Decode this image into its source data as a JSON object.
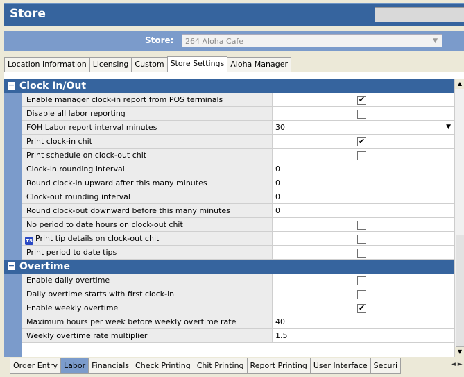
{
  "window": {
    "title": "Store"
  },
  "store_selector": {
    "label": "Store:",
    "value": "264 Aloha Cafe"
  },
  "top_tabs": [
    "Location Information",
    "Licensing",
    "Custom",
    "Store Settings",
    "Aloha Manager"
  ],
  "active_top_tab": "Store Settings",
  "sections": [
    {
      "title": "Clock In/Out",
      "rows": [
        {
          "label": "Enable manager clock-in report from POS terminals",
          "type": "checkbox",
          "checked": true
        },
        {
          "label": "Disable all labor reporting",
          "type": "checkbox",
          "checked": false
        },
        {
          "label": "FOH Labor report interval minutes",
          "type": "dropdown",
          "value": "30"
        },
        {
          "label": "Print clock-in chit",
          "type": "checkbox",
          "checked": true
        },
        {
          "label": "Print schedule on clock-out chit",
          "type": "checkbox",
          "checked": false
        },
        {
          "label": "Clock-in rounding interval",
          "type": "number",
          "value": "0"
        },
        {
          "label": "Round clock-in upward after this many minutes",
          "type": "number",
          "value": "0"
        },
        {
          "label": "Clock-out rounding interval",
          "type": "number",
          "value": "0"
        },
        {
          "label": "Round clock-out downward before this many minutes",
          "type": "number",
          "value": "0"
        },
        {
          "label": "No period to date hours on clock-out chit",
          "type": "checkbox",
          "checked": false
        },
        {
          "label": "Print tip details on clock-out chit",
          "type": "checkbox",
          "checked": false,
          "icon": "ts-icon",
          "icon_text": "TS"
        },
        {
          "label": "Print period to date tips",
          "type": "checkbox",
          "checked": false
        }
      ]
    },
    {
      "title": "Overtime",
      "rows": [
        {
          "label": "Enable daily overtime",
          "type": "checkbox",
          "checked": false
        },
        {
          "label": "Daily overtime starts with first clock-in",
          "type": "checkbox",
          "checked": false
        },
        {
          "label": "Enable weekly overtime",
          "type": "checkbox",
          "checked": true
        },
        {
          "label": "Maximum hours per week before weekly overtime rate",
          "type": "number",
          "value": "40"
        },
        {
          "label": "Weekly overtime rate multiplier",
          "type": "number",
          "value": "1.5"
        }
      ]
    }
  ],
  "bottom_tabs": [
    "Order Entry",
    "Labor",
    "Financials",
    "Check Printing",
    "Chit Printing",
    "Report Printing",
    "User Interface",
    "Securi"
  ],
  "active_bottom_tab": "Labor",
  "colors": {
    "title_bar": "#36649e",
    "section_header": "#36649e",
    "accent_light": "#7b9bcb",
    "background": "#ece9d8"
  }
}
